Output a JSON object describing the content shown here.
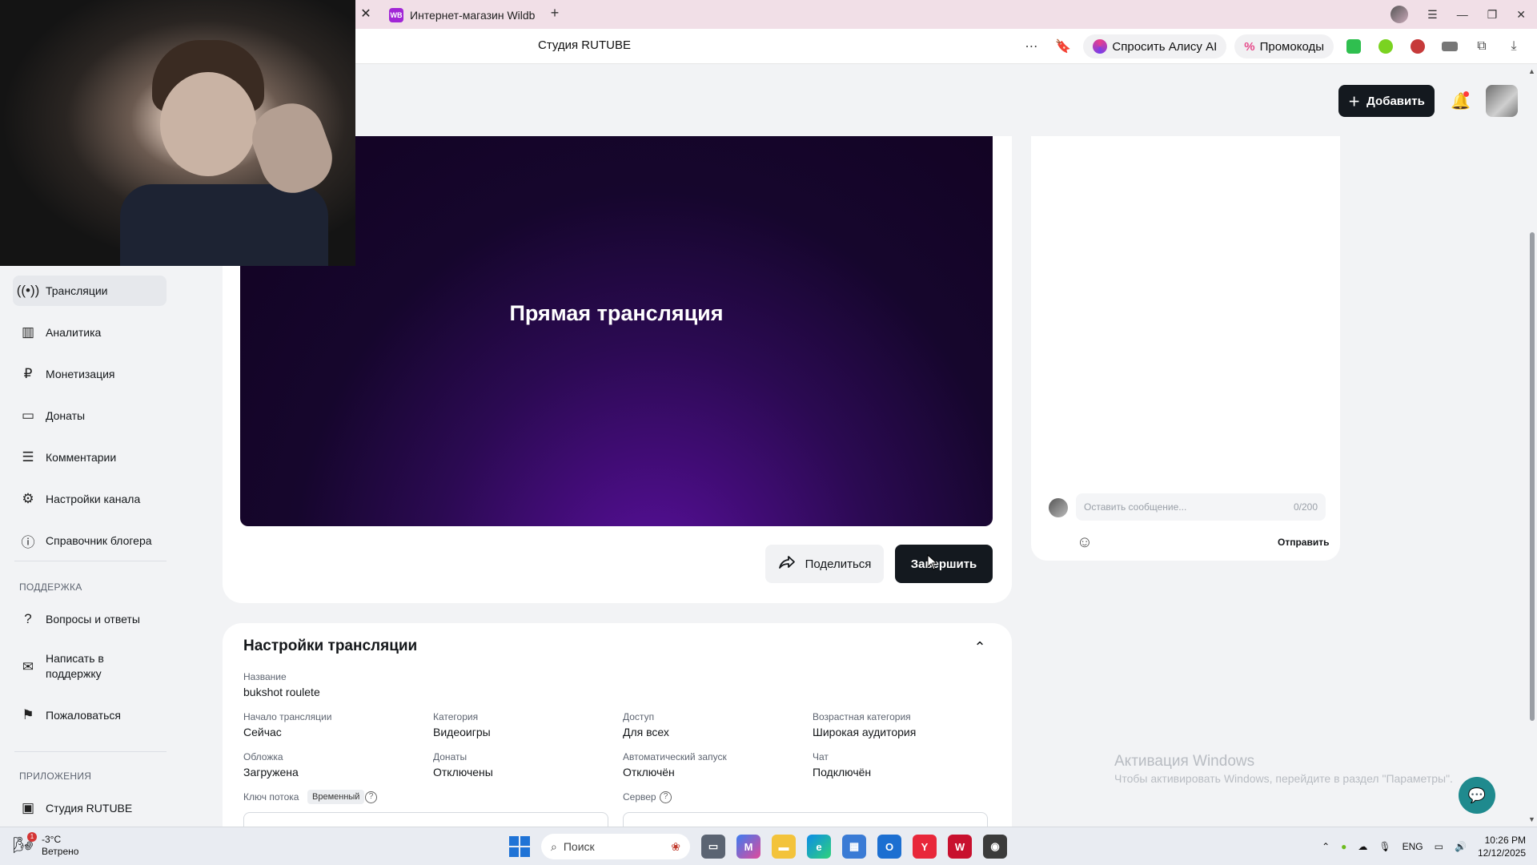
{
  "browser": {
    "tab_title": "Интернет-магазин Wildb",
    "tab_favicon": "WB",
    "page_title": "Студия RUTUBE",
    "alice_label": "Спросить Алису AI",
    "promo_label": "Промокоды"
  },
  "header": {
    "add_label": "Добавить"
  },
  "sidebar": {
    "items": [
      {
        "label": "Трансляции",
        "icon": "broadcast-icon"
      },
      {
        "label": "Аналитика",
        "icon": "chart-icon"
      },
      {
        "label": "Монетизация",
        "icon": "ruble-icon"
      },
      {
        "label": "Донаты",
        "icon": "wallet-icon"
      },
      {
        "label": "Комментарии",
        "icon": "comment-icon"
      },
      {
        "label": "Настройки канала",
        "icon": "gear-icon"
      },
      {
        "label": "Справочник блогера",
        "icon": "info-icon"
      }
    ],
    "support_label": "ПОДДЕРЖКА",
    "support_items": [
      {
        "label": "Вопросы и ответы",
        "icon": "question-icon"
      },
      {
        "label": "Написать в поддержку",
        "icon": "mail-icon"
      },
      {
        "label": "Пожаловаться",
        "icon": "flag-icon"
      }
    ],
    "apps_label": "ПРИЛОЖЕНИЯ",
    "apps_items": [
      {
        "label": "Студия RUTUBE",
        "icon": "studio-icon"
      }
    ]
  },
  "player": {
    "title": "Прямая трансляция",
    "share_label": "Поделиться",
    "end_label": "Завершить"
  },
  "chat": {
    "placeholder": "Оставить сообщение...",
    "counter": "0/200",
    "send_label": "Отправить"
  },
  "settings": {
    "title": "Настройки трансляции",
    "name_label": "Название",
    "name_value": "bukshot roulete",
    "fields": [
      {
        "label": "Начало трансляции",
        "value": "Сейчас"
      },
      {
        "label": "Категория",
        "value": "Видеоигры"
      },
      {
        "label": "Доступ",
        "value": "Для всех"
      },
      {
        "label": "Возрастная категория",
        "value": "Широкая аудитория"
      },
      {
        "label": "Обложка",
        "value": "Загружена"
      },
      {
        "label": "Донаты",
        "value": "Отключены"
      },
      {
        "label": "Автоматический запуск",
        "value": "Отключён"
      },
      {
        "label": "Чат",
        "value": "Подключён"
      }
    ],
    "stream_key_label": "Ключ потока",
    "stream_key_badge": "Временный",
    "server_label": "Сервер"
  },
  "watermark": {
    "line1": "Активация Windows",
    "line2": "Чтобы активировать Windows, перейдите в раздел \"Параметры\"."
  },
  "taskbar": {
    "weather_badge": "1",
    "temperature": "-3°C",
    "weather_desc": "Ветрено",
    "search_placeholder": "Поиск",
    "lang": "ENG",
    "time": "10:26 PM",
    "date": "12/12/2025"
  },
  "colors": {
    "accent_dark": "#14191f",
    "player_purple": "#5a0f9e",
    "page_bg": "#f2f3f5"
  }
}
